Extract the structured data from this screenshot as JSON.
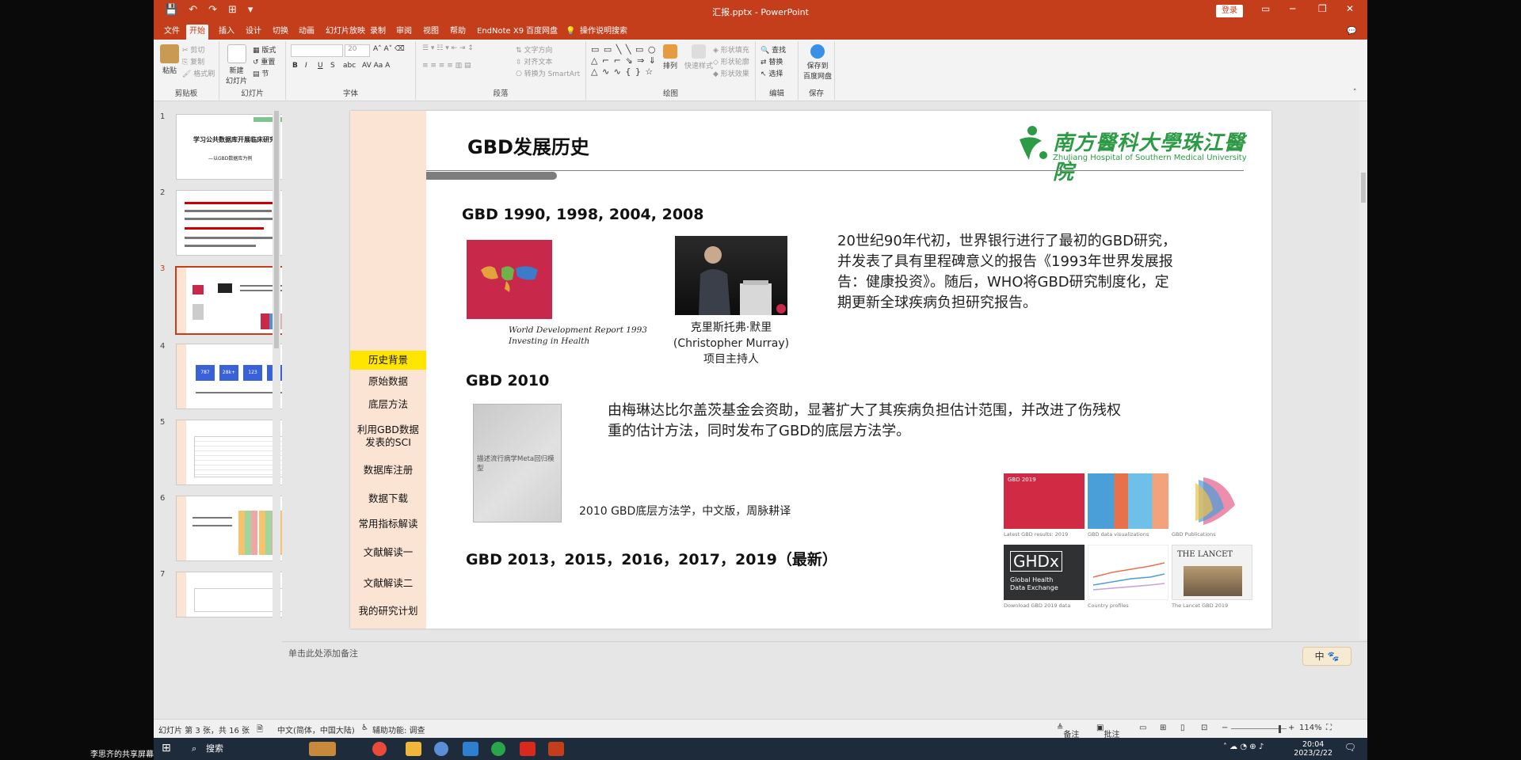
{
  "window": {
    "doc_title": "汇报.pptx - PowerPoint",
    "login_label": "登录",
    "minimize": "─",
    "restore": "❐",
    "close": "✕"
  },
  "menu": {
    "items": [
      "文件",
      "开始",
      "插入",
      "设计",
      "切换",
      "动画",
      "幻灯片放映",
      "录制",
      "审阅",
      "视图",
      "帮助",
      "EndNote X9",
      "百度网盘"
    ],
    "search_label": "操作说明搜索"
  },
  "ribbon": {
    "clipboard": {
      "paste": "粘贴",
      "cut": "剪切",
      "copy": "复制",
      "format_painter": "格式刷",
      "label": "剪贴板"
    },
    "slides": {
      "new_slide": "新建",
      "new_slide_2": "幻灯片",
      "layout": "版式",
      "reset": "重置",
      "section": "节",
      "label": "幻灯片"
    },
    "font": {
      "size": "20",
      "label": "字体"
    },
    "paragraph": {
      "text_direction": "文字方向",
      "align_text": "对齐文本",
      "smartart": "转换为 SmartArt",
      "label": "段落"
    },
    "drawing": {
      "arrange": "排列",
      "quick_styles": "快速样式",
      "shape_fill": "形状填充",
      "shape_outline": "形状轮廓",
      "shape_effects": "形状效果",
      "label": "绘图"
    },
    "editing": {
      "find": "查找",
      "replace": "替换",
      "select": "选择",
      "label": "编辑"
    },
    "save": {
      "save_to": "保存到",
      "baidu": "百度网盘",
      "label": "保存"
    }
  },
  "thumbnails": {
    "numbers": [
      "1",
      "2",
      "3",
      "4",
      "5",
      "6",
      "7"
    ],
    "slide1_title": "学习公共数据库开展临床研究",
    "slide1_sub": "—以GBD数据库为例",
    "slide4_stats": [
      "787",
      "28k+",
      "123",
      "35"
    ]
  },
  "slide": {
    "title": "GBD发展历史",
    "logo_cn": "南方醫科大學珠江醫院",
    "logo_en": "ZhuJiang Hospital of Southern Medical University",
    "nav": [
      "历史背景",
      "原始数据",
      "底层方法",
      "利用GBD数据发表的SCI",
      "数据库注册",
      "数据下载",
      "常用指标解读",
      "文献解读一",
      "文献解读二",
      "我的研究计划"
    ],
    "sections": {
      "s1_head": "GBD 1990, 1998, 2004, 2008",
      "wdr_title_1": "World Development Report 1993",
      "wdr_title_2": "Investing in Health",
      "murray_cap_1": "克里斯托弗·默里",
      "murray_cap_2": "(Christopher Murray)",
      "murray_cap_3": "项目主持人",
      "s1_text_1": "20世纪90年代初，世界银行进行了最初的GBD研究，",
      "s1_text_2": "并发表了具有里程碑意义的报告《1993年世界发展报",
      "s1_text_3": "告：健康投资》。随后，WHO将GBD研究制度化，定",
      "s1_text_4": "期更新全球疾病负担研究报告。",
      "s2_head": "GBD 2010",
      "s2_text_1": "由梅琳达比尔盖茨基金会资助，显著扩大了其疾病负担估计范围，并改进了伤残权",
      "s2_text_2": "重的估计方法，同时发布了GBD的底层方法学。",
      "book_title": "描述流行病学Meta回归模型",
      "book_cap": "2010 GBD底层方法学，中文版，周脉耕译",
      "s3_head": "GBD 2013，2015，2016，2017，2019（最新）"
    },
    "tiles": {
      "t1_label": "GBD 2019",
      "t4_label": "GHDx",
      "t4_sub_1": "Global Health",
      "t4_sub_2": "Data Exchange",
      "t6_label": "THE LANCET",
      "caps": [
        "Latest GBD results: 2019",
        "GBD data visualizations",
        "GBD Publications",
        "Download GBD 2019 data",
        "Country profiles",
        "The Lancet GBD 2019"
      ]
    }
  },
  "notes": {
    "placeholder": "单击此处添加备注"
  },
  "ime": {
    "label": "中"
  },
  "status": {
    "slide_count": "幻灯片 第 3 张，共 16 张",
    "language": "中文(简体，中国大陆)",
    "accessibility": "辅助功能: 调查",
    "notes_btn": "备注",
    "comments_btn": "批注",
    "zoom": "114%"
  },
  "taskbar": {
    "search": "搜索",
    "time": "20:04",
    "date": "2023/2/22",
    "user_share": "李思齐的共享屏幕"
  },
  "colors": {
    "accent": "#c43e1c",
    "nav_active": "#ffe500",
    "nav_bg": "#fce4d4",
    "logo_green": "#2d9a45"
  }
}
